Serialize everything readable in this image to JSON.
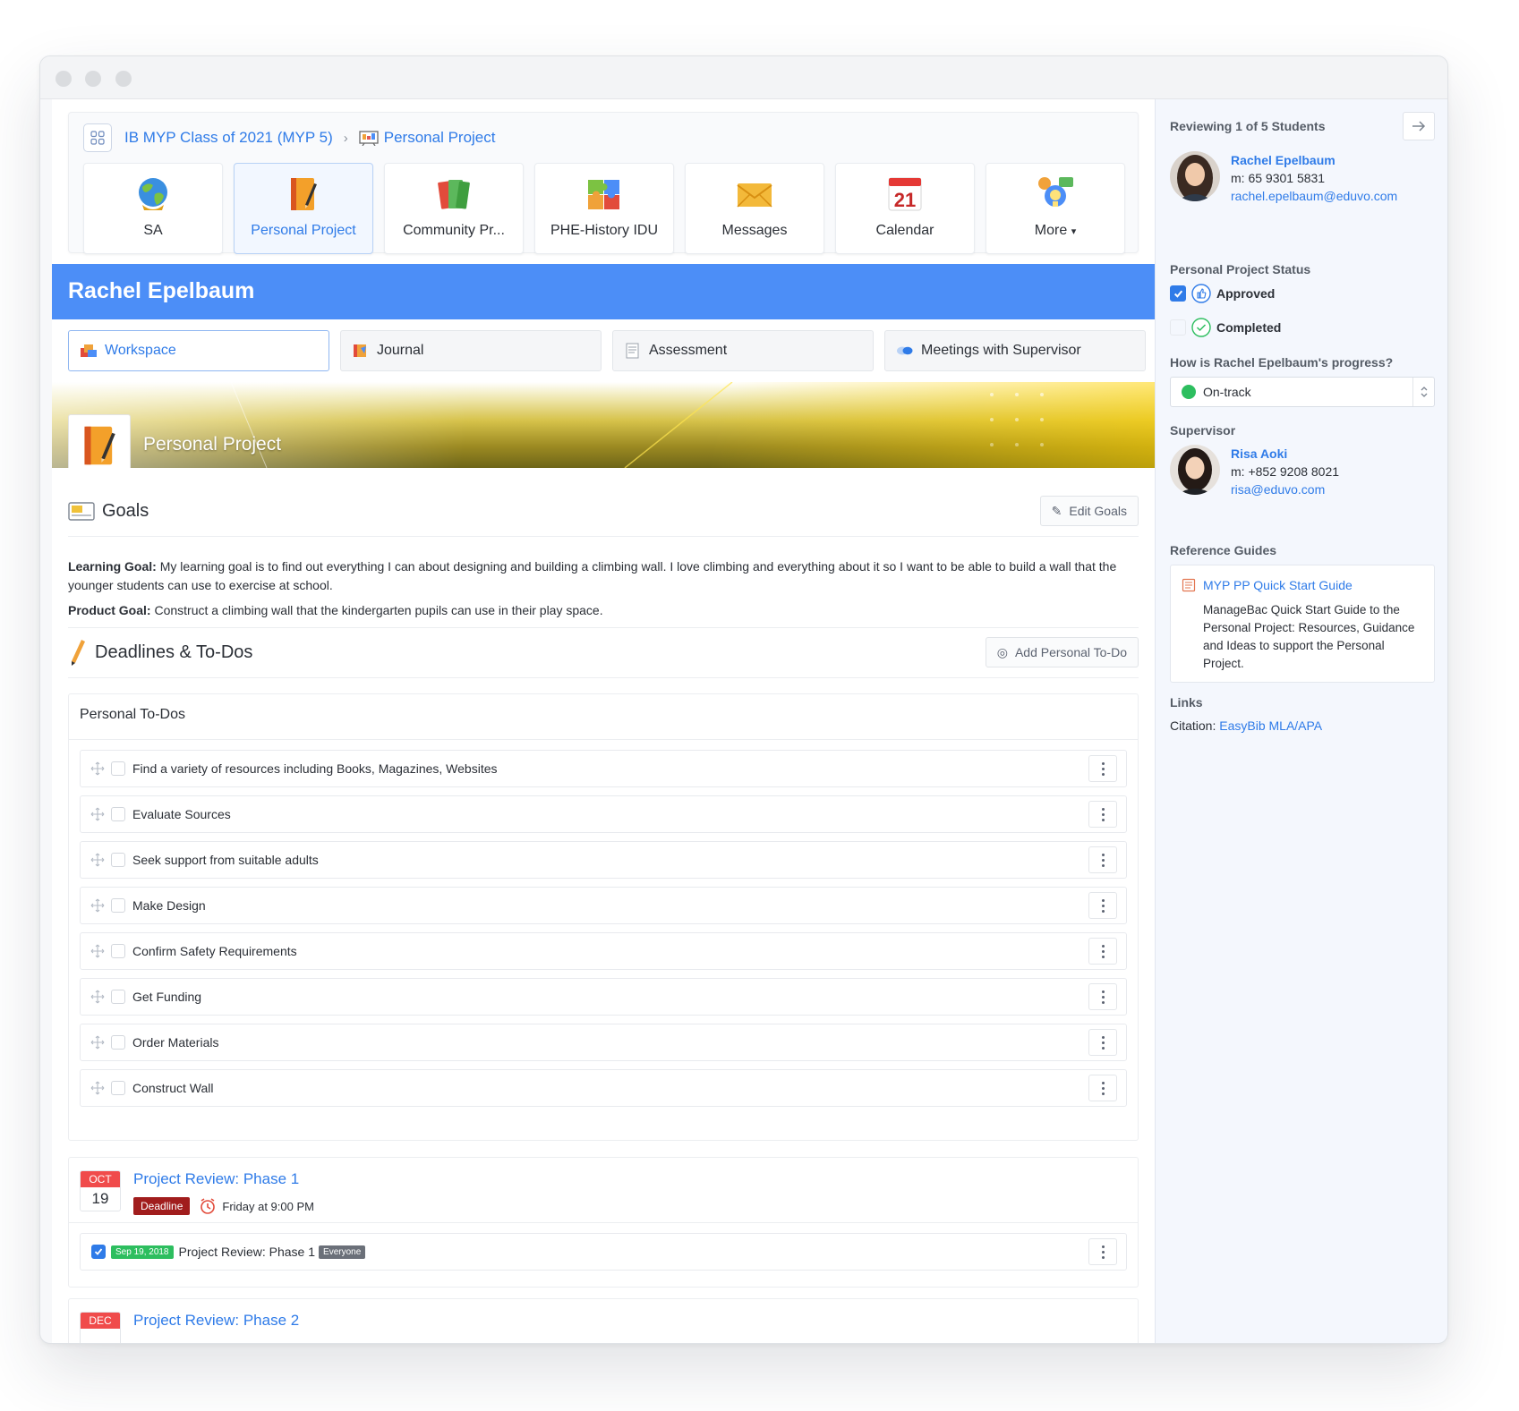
{
  "breadcrumb": {
    "class_name": "IB MYP Class of 2021 (MYP 5)",
    "separator": "›",
    "current": "Personal Project"
  },
  "apps": [
    {
      "label": "SA",
      "icon": "globe-icon",
      "active": false
    },
    {
      "label": "Personal Project",
      "icon": "notebook-icon",
      "active": true
    },
    {
      "label": "Community Pr...",
      "icon": "books-icon",
      "active": false
    },
    {
      "label": "PHE-History IDU",
      "icon": "puzzle-icon",
      "active": false
    },
    {
      "label": "Messages",
      "icon": "envelope-icon",
      "active": false
    },
    {
      "label": "Calendar",
      "icon": "calendar-icon",
      "active": false,
      "day": "21"
    },
    {
      "label": "More",
      "icon": "lightbulb-chat-icon",
      "active": false
    }
  ],
  "student_name": "Rachel Epelbaum",
  "subtabs": [
    {
      "label": "Workspace",
      "active": true
    },
    {
      "label": "Journal",
      "active": false
    },
    {
      "label": "Assessment",
      "active": false
    },
    {
      "label": "Meetings with Supervisor",
      "active": false
    }
  ],
  "banner": {
    "title": "Personal Project"
  },
  "goals": {
    "title": "Goals",
    "edit_label": "Edit Goals",
    "learning_label": "Learning Goal:",
    "learning_text": "My learning goal is to find out everything I can about designing and building a climbing wall. I love climbing and everything about it so I want to be able to build a wall that the younger students can use to exercise at school.",
    "product_label": "Product Goal:",
    "product_text": "Construct a climbing wall that the kindergarten pupils can use in their play space."
  },
  "deadlines": {
    "title": "Deadlines & To-Dos",
    "add_label": "Add Personal To-Do",
    "personal_title": "Personal To-Dos",
    "todos": [
      "Find a variety of resources including Books, Magazines, Websites",
      "Evaluate Sources",
      "Seek support from suitable adults",
      "Make Design",
      "Confirm Safety Requirements",
      "Get Funding",
      "Order Materials",
      "Construct Wall"
    ],
    "items": [
      {
        "month": "OCT",
        "day": "19",
        "title": "Project Review: Phase 1",
        "badge": "Deadline",
        "time": "Friday at 9:00 PM",
        "sub": {
          "date_badge": "Sep 19, 2018",
          "text": "Project Review: Phase 1",
          "audience": "Everyone",
          "checked": true
        }
      },
      {
        "month": "DEC",
        "title": "Project Review: Phase 2"
      }
    ]
  },
  "sidebar": {
    "reviewing": "Reviewing 1 of 5 Students",
    "student": {
      "name": "Rachel Epelbaum",
      "phone": "m: 65 9301 5831",
      "email": "rachel.epelbaum@eduvo.com"
    },
    "status_title": "Personal Project Status",
    "approved_label": "Approved",
    "approved_checked": true,
    "completed_label": "Completed",
    "completed_checked": false,
    "progress_question": "How is Rachel Epelbaum's progress?",
    "progress_value": "On-track",
    "supervisor_title": "Supervisor",
    "supervisor": {
      "name": "Risa Aoki",
      "phone": "m: +852 9208 8021",
      "email": "risa@eduvo.com"
    },
    "guides_title": "Reference Guides",
    "guide": {
      "title": "MYP PP Quick Start Guide",
      "description": "ManageBac Quick Start Guide to the Personal Project: Resources, Guidance and Ideas to support the Personal Project."
    },
    "links_title": "Links",
    "citation_label": "Citation:",
    "citation_link": "EasyBib MLA/APA"
  },
  "colors": {
    "accent": "#2f7be8",
    "namebar": "#4c8ef7",
    "deadline": "#a11d1d",
    "ontrack": "#2dbe5f",
    "calendar_red": "#f04b4b"
  }
}
